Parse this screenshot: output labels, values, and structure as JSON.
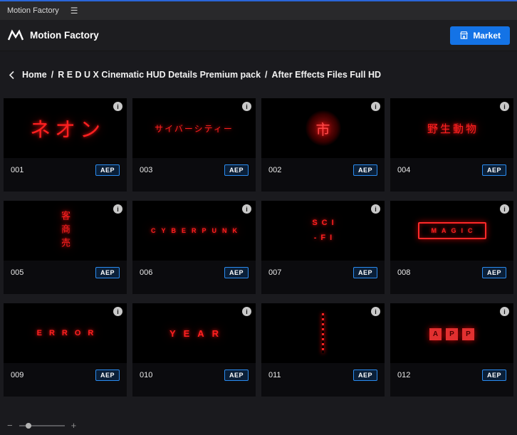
{
  "icons": {
    "menu": "☰",
    "info": "i"
  },
  "titlebar": {
    "title": "Motion Factory"
  },
  "header": {
    "app_name": "Motion Factory",
    "market_label": "Market"
  },
  "breadcrumb": {
    "separator": "/",
    "items": [
      "Home",
      "R E D U X Cinematic HUD Details Premium pack",
      "After Effects Files Full HD"
    ]
  },
  "colors": {
    "accent_blue": "#1473e6",
    "neon_red": "#ff2020"
  },
  "grid": {
    "badge_label": "AEP",
    "items": [
      {
        "id": "001",
        "thumb_text": "ネオン",
        "style": "large"
      },
      {
        "id": "003",
        "thumb_text": "サイバーシティー",
        "style": "medium"
      },
      {
        "id": "002",
        "thumb_text": "市",
        "style": "circle"
      },
      {
        "id": "004",
        "thumb_text": "野生動物",
        "style": "medium-large"
      },
      {
        "id": "005",
        "thumb_text": "客商売",
        "style": "vertical"
      },
      {
        "id": "006",
        "thumb_text": "CYBERPUNK",
        "style": "spaced-small"
      },
      {
        "id": "007",
        "thumb_text": "SCI\n-FI",
        "style": "twoline"
      },
      {
        "id": "008",
        "thumb_text": "MAGIC",
        "style": "boxed"
      },
      {
        "id": "009",
        "thumb_text": "ERROR",
        "style": "spaced"
      },
      {
        "id": "010",
        "thumb_text": "YEAR",
        "style": "spaced-bold"
      },
      {
        "id": "011",
        "thumb_text": "",
        "style": "dots",
        "motif": "vertical-dotted-line"
      },
      {
        "id": "012",
        "thumb_text": "APP",
        "style": "letterboxes"
      }
    ]
  },
  "zoom_control": {
    "minus": "−",
    "plus": "+",
    "value_pct": 14
  }
}
